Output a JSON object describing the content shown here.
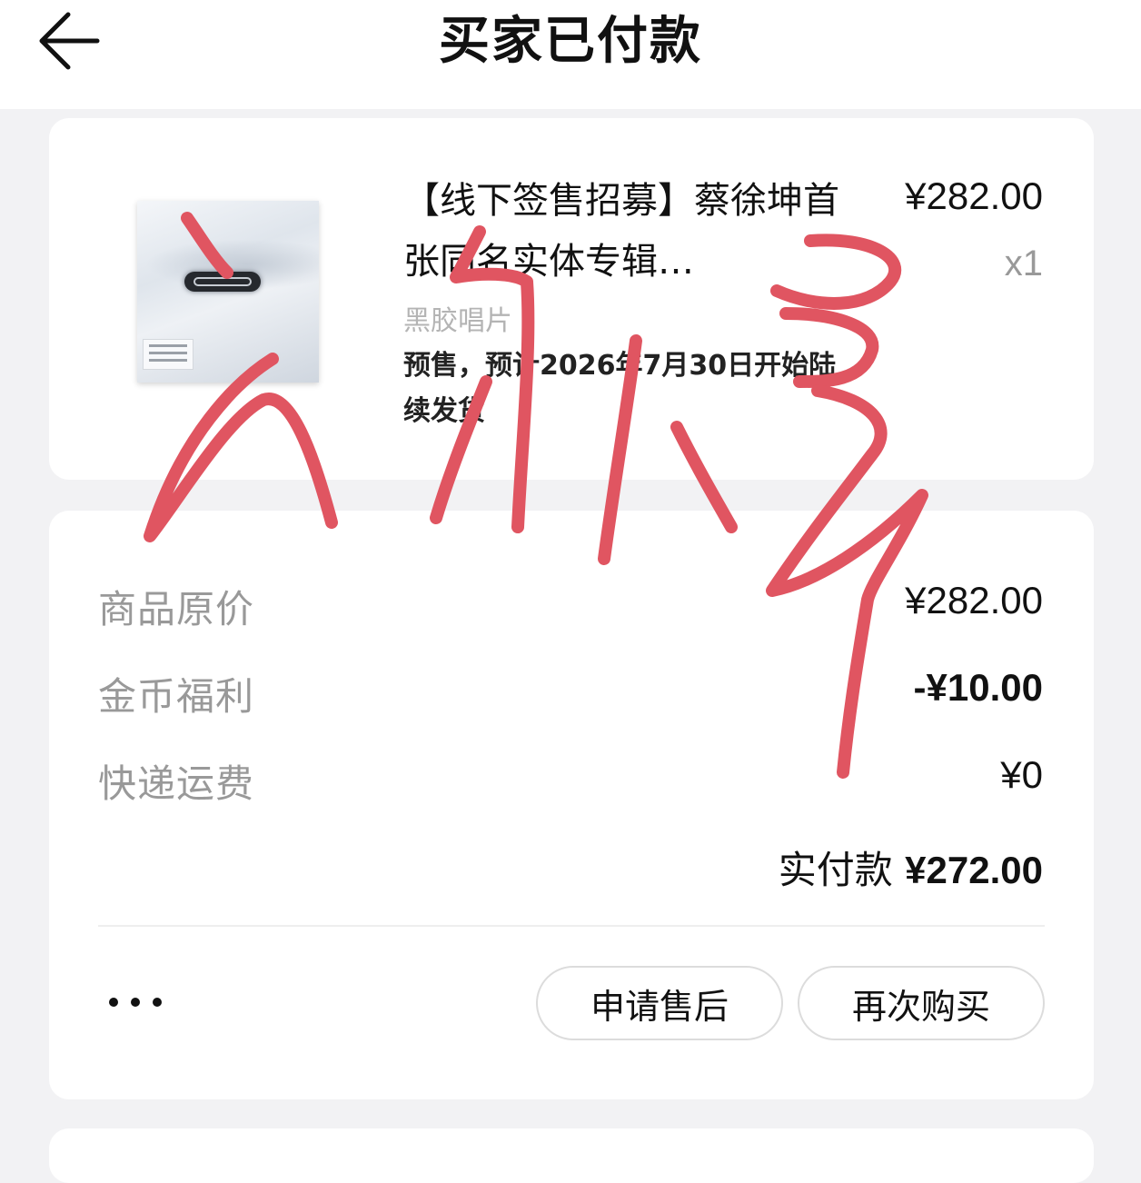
{
  "header": {
    "title": "买家已付款",
    "back_icon": "arrow-left-icon"
  },
  "product": {
    "title": "【线下签售招募】蔡徐坤首张同名实体专辑…",
    "price": "¥282.00",
    "quantity": "x1",
    "shop": "黑胶唱片",
    "presale_note": "预售，预计2026年7月30日开始陆续发货"
  },
  "summary": {
    "original_price_label": "商品原价",
    "original_price_value": "¥282.00",
    "coin_label": "金币福利",
    "coin_value": "-¥10.00",
    "shipping_label": "快递运费",
    "shipping_value": "¥0",
    "paid_label": "实付款",
    "paid_value": "¥272.00"
  },
  "actions": {
    "more_icon": "more-dots-icon",
    "after_sale": "申请售后",
    "buy_again": "再次购买"
  },
  "colors": {
    "scribble": "#e05561",
    "muted_text": "#999999",
    "background": "#f2f2f4"
  }
}
